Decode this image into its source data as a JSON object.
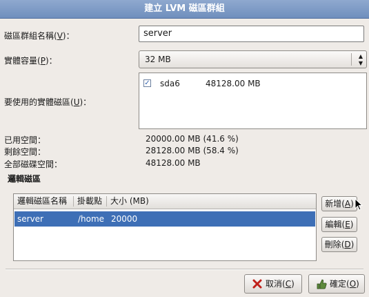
{
  "window": {
    "title": "建立 LVM 磁區群組"
  },
  "form": {
    "vg_name_label": "磁區群組名稱",
    "vg_name_key": "V",
    "vg_name_value": "server",
    "pe_label": "實體容量",
    "pe_key": "P",
    "pe_value": "32 MB",
    "pv_label": "要使用的實體磁區",
    "pv_key": "U",
    "pv_items": [
      {
        "checked": true,
        "device": "sda6",
        "size": "48128.00 MB"
      }
    ]
  },
  "space": {
    "used_label": "已用空間：",
    "used_value": "20000.00 MB",
    "used_pct": "(41.6 %)",
    "free_label": "剩餘空間：",
    "free_value": "28128.00 MB",
    "free_pct": "(58.4 %)",
    "total_label": "全部磁碟空間：",
    "total_value": "48128.00 MB"
  },
  "lv_section": {
    "title": "邏輯磁區",
    "columns": [
      "邏輯磁區名稱",
      "掛載點",
      "大小 (MB)"
    ],
    "rows": [
      {
        "name": "server",
        "mount": "/home",
        "size": "20000",
        "selected": true
      }
    ]
  },
  "side_buttons": {
    "add_label": "新增",
    "add_key": "A",
    "edit_label": "編輯",
    "edit_key": "E",
    "delete_label": "刪除",
    "delete_key": "D"
  },
  "footer": {
    "cancel_label": "取消",
    "cancel_key": "C",
    "ok_label": "確定",
    "ok_key": "O"
  },
  "colors": {
    "accent": "#3e6fb6",
    "titlebar": "#7f9cc8"
  },
  "icons": {
    "checkbox": "checked-checkbox-icon",
    "cancel": "x-icon",
    "ok": "thumbs-up-icon",
    "pointer": "mouse-pointer-icon"
  }
}
